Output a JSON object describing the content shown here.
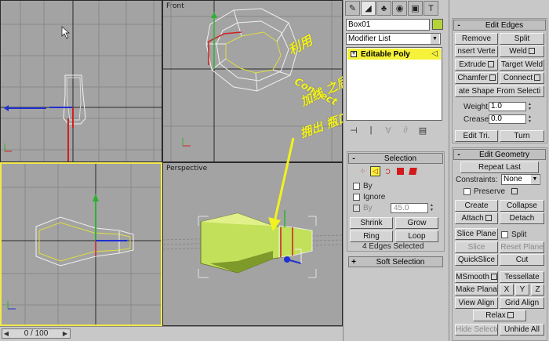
{
  "viewports": {
    "top_left": {
      "label": ""
    },
    "front": {
      "label": "Front"
    },
    "left": {
      "label": ""
    },
    "perspective": {
      "label": "Perspective"
    }
  },
  "timeline": {
    "frame_text": "0 / 100",
    "current": 0,
    "total": 100
  },
  "annotation": {
    "lines": [
      "利用",
      "Connect",
      "加线 之后",
      "拥出 瓶口"
    ],
    "color": "#f2f21e"
  },
  "command_panel": {
    "tabs": [
      {
        "icon": "create-icon",
        "glyph": "✎"
      },
      {
        "icon": "modify-icon",
        "glyph": "◢"
      },
      {
        "icon": "hierarchy-icon",
        "glyph": "♣"
      },
      {
        "icon": "motion-icon",
        "glyph": "◉"
      },
      {
        "icon": "display-icon",
        "glyph": "▣"
      },
      {
        "icon": "utilities-icon",
        "glyph": "T"
      }
    ],
    "object_name": "Box01",
    "object_color": "#b4d23a",
    "modifier_list": "Modifier List",
    "stack_item": "Editable Poly",
    "stack_tools": [
      "⊣",
      "|",
      "∀",
      "∂",
      "▤"
    ],
    "selection": {
      "title": "Selection",
      "by_vertex": "By",
      "ignore": "Ignore",
      "by_angle": "By",
      "angle_value": "45.0",
      "shrink": "Shrink",
      "grow": "Grow",
      "ring": "Ring",
      "loop": "Loop",
      "status": "4 Edges Selected"
    },
    "soft_selection": {
      "title": "Soft Selection"
    }
  },
  "edit_edges": {
    "title": "Edit Edges",
    "remove": "Remove",
    "split": "Split",
    "insert_vertex": "nsert Verte",
    "weld": "Weld",
    "extrude": "Extrude",
    "target_weld": "Target Weld",
    "chamfer": "Chamfer",
    "connect": "Connect",
    "create_shape": "ate Shape From Selecti",
    "weight_label": "Weight:",
    "weight_value": "1.0",
    "crease_label": "Crease:",
    "crease_value": "0.0",
    "edit_tri": "Edit Tri.",
    "turn": "Turn"
  },
  "edit_geometry": {
    "title": "Edit Geometry",
    "repeat_last": "Repeat Last",
    "constraints_label": "Constraints:",
    "constraints_value": "None",
    "preserve": "Preserve",
    "create": "Create",
    "collapse": "Collapse",
    "attach": "Attach",
    "detach": "Detach",
    "slice_plane": "Slice Plane",
    "split": "Split",
    "slice": "Slice",
    "reset_plane": "Reset Plane",
    "quickslice": "QuickSlice",
    "cut": "Cut",
    "msmooth": "MSmooth",
    "tessellate": "Tessellate",
    "make_planar": "Make Planar",
    "x": "X",
    "y": "Y",
    "z": "Z",
    "view_align": "View Align",
    "grid_align": "Grid Align",
    "relax": "Relax",
    "hide_selected": "Hide Selected",
    "unhide_all": "Unhide All"
  }
}
